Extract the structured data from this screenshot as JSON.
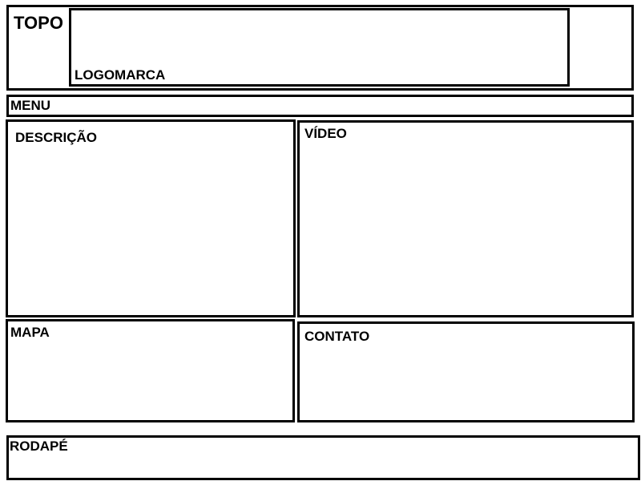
{
  "wireframe": {
    "topo": "TOPO",
    "logomarca": "LOGOMARCA",
    "menu": "MENU",
    "descricao": "DESCRIÇÃO",
    "video": "VÍDEO",
    "mapa": "MAPA",
    "contato": "CONTATO",
    "rodape": "RODAPÉ"
  }
}
